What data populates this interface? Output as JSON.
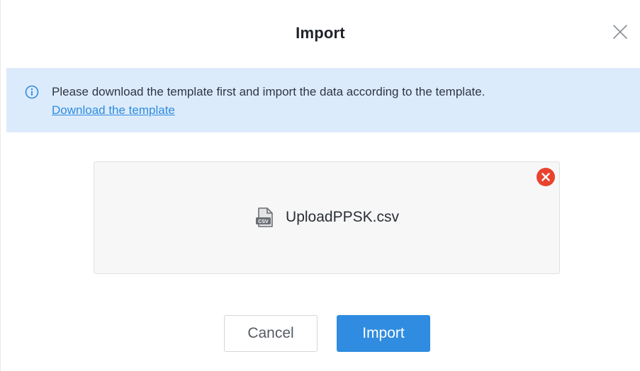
{
  "dialog": {
    "title": "Import",
    "close_icon": "close-icon"
  },
  "info": {
    "icon": "info-circle-icon",
    "message": "Please download the template first and import the data according to the template.",
    "link_text": "Download the template",
    "background_color": "#dcebfb",
    "link_color": "#2f8ce0"
  },
  "upload": {
    "file_icon": "csv-file-icon",
    "file_name": "UploadPPSK.csv",
    "remove_icon": "remove-file-icon",
    "remove_color": "#e8432e"
  },
  "actions": {
    "cancel_label": "Cancel",
    "import_label": "Import",
    "primary_color": "#2f8ce0"
  }
}
